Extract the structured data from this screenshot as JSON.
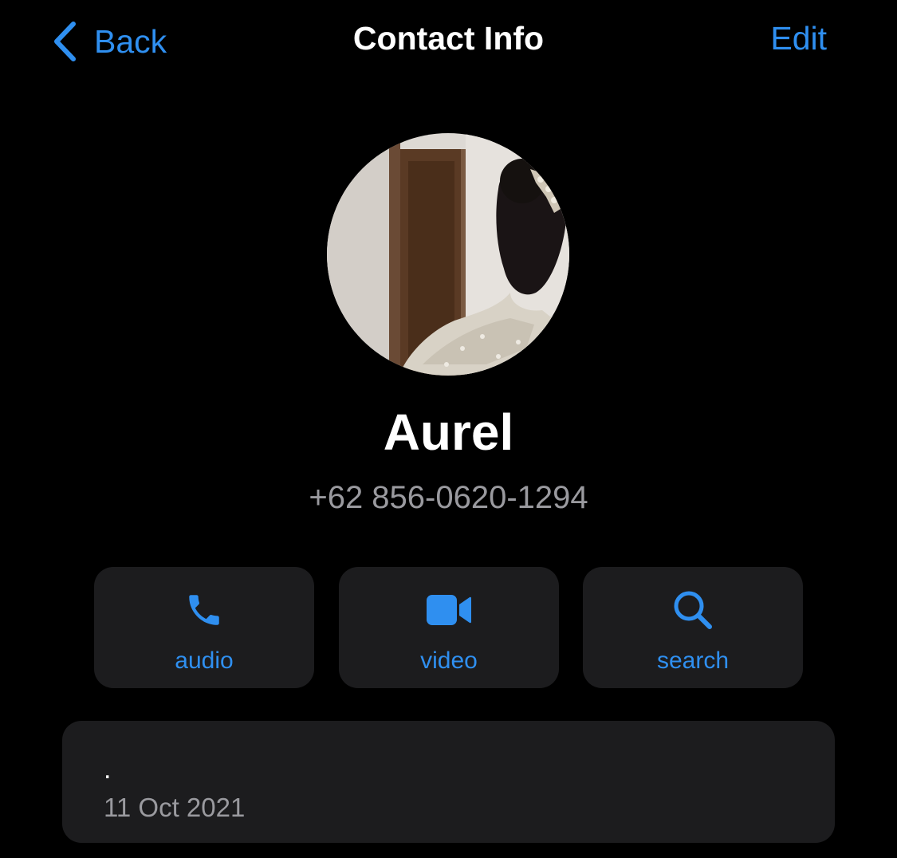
{
  "nav": {
    "back_label": "Back",
    "title": "Contact Info",
    "edit_label": "Edit"
  },
  "contact": {
    "name": "Aurel",
    "phone": "+62 856-0620-1294",
    "avatar_icon": "profile-photo"
  },
  "actions": [
    {
      "label": "audio",
      "icon": "phone-icon"
    },
    {
      "label": "video",
      "icon": "video-camera-icon"
    },
    {
      "label": "search",
      "icon": "search-icon"
    }
  ],
  "about": {
    "text": ".",
    "date": "11 Oct 2021"
  },
  "colors": {
    "background": "#000000",
    "accent": "#2f8ff0",
    "card": "#1c1c1e",
    "secondary_text": "#9a9a9f"
  }
}
